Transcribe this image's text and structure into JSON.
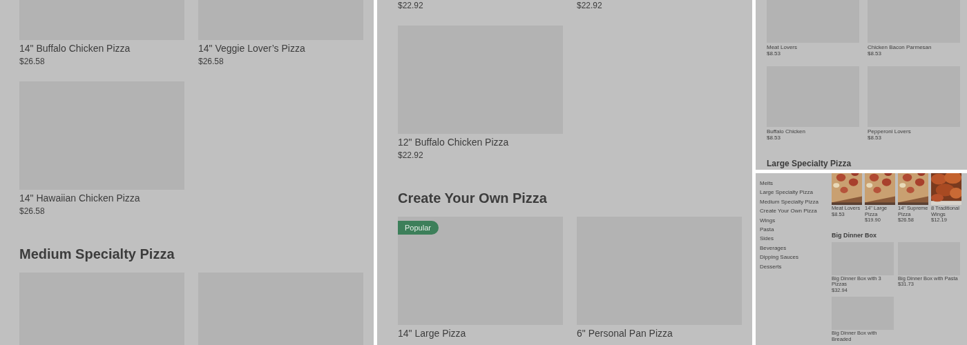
{
  "panels": [
    {
      "kind": "wide",
      "sections": [
        {
          "items": [
            {
              "kind": "card",
              "name": "14\" Buffalo Chicken Pizza",
              "price": "$26.58"
            },
            {
              "kind": "card",
              "name": "14\" Veggie Lover’s Pizza",
              "price": "$26.58"
            },
            {
              "kind": "card",
              "name": "14\" Hawaiian Chicken Pizza",
              "price": "$26.58"
            }
          ]
        },
        {
          "heading": "Medium Specialty Pizza",
          "items": [
            {
              "kind": "card"
            },
            {
              "kind": "card"
            }
          ]
        }
      ]
    },
    {
      "kind": "wide",
      "sections": [
        {
          "items": [
            {
              "kind": "text",
              "price": "$22.92"
            },
            {
              "kind": "text",
              "price": "$22.92"
            },
            {
              "kind": "card",
              "name": "12\" Buffalo Chicken Pizza",
              "price": "$22.92"
            }
          ]
        },
        {
          "heading": "Create Your Own Pizza",
          "items": [
            {
              "kind": "card",
              "badge": "Popular",
              "name": "14\" Large Pizza"
            },
            {
              "kind": "card",
              "name": "6\" Personal Pan Pizza"
            }
          ]
        }
      ]
    },
    {
      "kind": "compact",
      "sections": [
        {
          "items": [
            {
              "kind": "card",
              "name": "Meat Lovers",
              "price": "$8.53"
            },
            {
              "kind": "card",
              "name": "Chicken Bacon Parmesan",
              "price": "$8.53"
            },
            {
              "kind": "card",
              "name": "Buffalo Chicken",
              "price": "$8.53"
            },
            {
              "kind": "card",
              "name": "Pepperoni Lovers",
              "price": "$8.53"
            }
          ]
        },
        {
          "heading": "Large Specialty Pizza"
        }
      ]
    },
    {
      "kind": "overview",
      "sidebar": [
        "Melts",
        "Large Specialty Pizza",
        "Medium Specialty Pizza",
        "Create Your Own Pizza",
        "Wings",
        "Pasta",
        "Sides",
        "Beverages",
        "Dipping Sauces",
        "Desserts"
      ],
      "sections": [
        {
          "items": [
            {
              "name": "Meat Lovers",
              "price": "$8.53"
            },
            {
              "name": "14\" Large Pizza",
              "price": "$19.90"
            },
            {
              "name": "14\" Supreme Pizza",
              "price": "$26.58"
            },
            {
              "name": "8 Traditional Wings",
              "price": "$12.19"
            }
          ]
        },
        {
          "heading": "Big Dinner Box",
          "items": [
            {
              "kind": "card",
              "name": "Big Dinner Box with 3 Pizzas",
              "price": "$32.94"
            },
            {
              "kind": "card",
              "name": "Big Dinner Box with Pasta",
              "price": "$31.73"
            },
            {
              "kind": "card",
              "name": "Big Dinner Box with Breaded"
            }
          ]
        }
      ]
    }
  ]
}
